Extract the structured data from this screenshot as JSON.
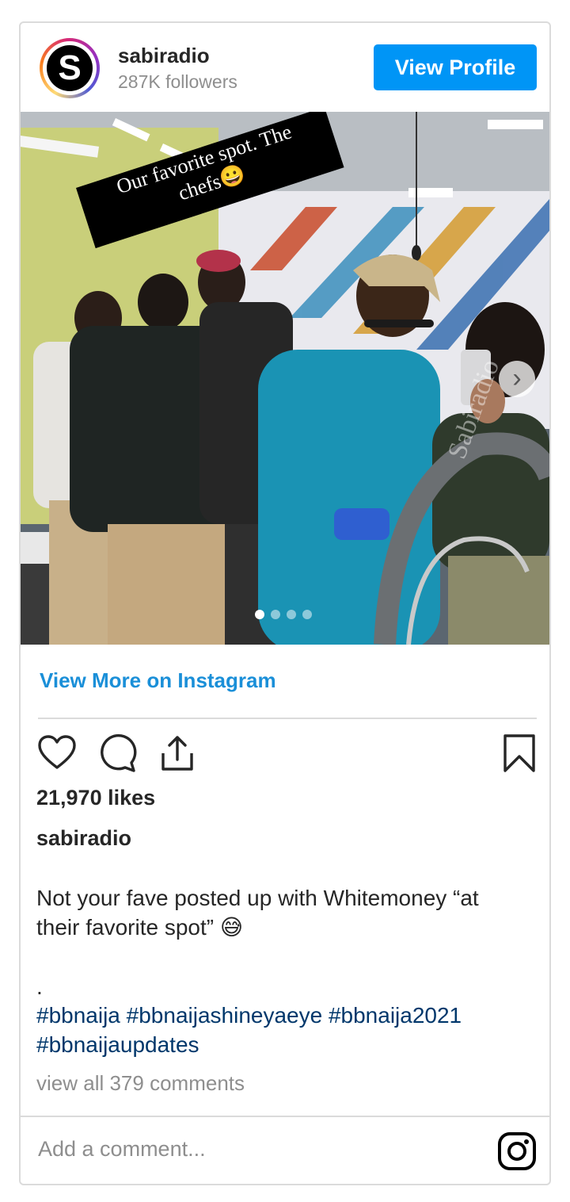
{
  "post": {
    "username": "sabiradio",
    "avatar_letter": "S",
    "followers": "287K followers",
    "view_profile_label": "View Profile",
    "image": {
      "sticker_line1": "Our favorite spot. The",
      "sticker_line2": "chefs😀",
      "watermark": "Sabiradio",
      "carousel_total": 4,
      "carousel_active": 1
    },
    "view_more_label": "View More on Instagram",
    "likes": "21,970 likes",
    "caption_user": "sabiradio",
    "caption_text": "Not your fave posted up with Whitemoney “at their favorite spot” 😅",
    "caption_dot": ".",
    "hashtags": "#bbnaija #bbnaijashineyaeye #bbnaija2021 #bbnaijaupdates",
    "view_all_comments": "view all 379 comments",
    "comment_placeholder": "Add a comment..."
  },
  "colors": {
    "accent": "#0095f6",
    "link": "#1a8fd8",
    "hashtag": "#00376b",
    "muted": "#8e8e8e"
  },
  "icons": [
    "heart-icon",
    "comment-icon",
    "share-icon",
    "bookmark-icon",
    "instagram-icon",
    "chevron-right-icon"
  ]
}
